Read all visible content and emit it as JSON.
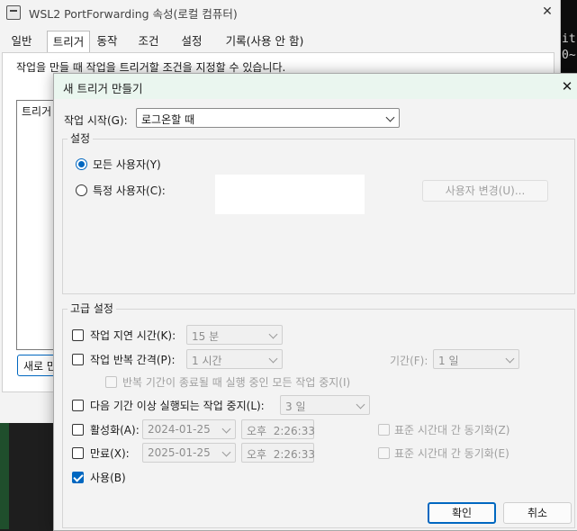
{
  "terminal": {
    "lines": [
      "it",
      "0~"
    ]
  },
  "back_window": {
    "title": "WSL2 PortForwarding 속성(로컬 컴퓨터)",
    "close_glyph": "✕",
    "tabs": [
      "일반",
      "트리거",
      "동작",
      "조건",
      "설정",
      "기록(사용 안 함)"
    ],
    "active_tab": "트리거",
    "description": "작업을 만들 때 작업을 트리거할 조건을 지정할 수 있습니다.",
    "list_header": "트리거",
    "new_button": "새로 만"
  },
  "dialog": {
    "title": "새 트리거 만들기",
    "close_glyph": "✕",
    "start_task_label": "작업 시작(G):",
    "start_task_value": "로그온할 때",
    "settings_group": "설정",
    "all_users_label": "모든 사용자(Y)",
    "specific_user_label": "특정 사용자(C):",
    "change_user_button": "사용자 변경(U)...",
    "advanced_group": "고급 설정",
    "delay_label": "작업 지연 시간(K):",
    "delay_value": "15 분",
    "repeat_label": "작업 반복 간격(P):",
    "repeat_value": "1 시간",
    "duration_label": "기간(F):",
    "duration_value": "1 일",
    "stop_repeat_label": "반복 기간이 종료될 때 실행 중인 모든 작업 중지(I)",
    "stop_longer_label": "다음 기간 이상 실행되는 작업 중지(L):",
    "stop_longer_value": "3 일",
    "activate_label": "활성화(A):",
    "activate_date": "2024-01-25",
    "activate_time": "오후  2:26:33",
    "sync_tz_1": "표준 시간대 간 동기화(Z)",
    "expire_label": "만료(X):",
    "expire_date": "2025-01-25",
    "expire_time": "오후  2:26:33",
    "sync_tz_2": "표준 시간대 간 동기화(E)",
    "enabled_label": "사용(B)",
    "ok_button": "확인",
    "cancel_button": "취소"
  },
  "colors": {
    "accent": "#0067c0",
    "dialog_title_bg": "#eaf6ef"
  }
}
